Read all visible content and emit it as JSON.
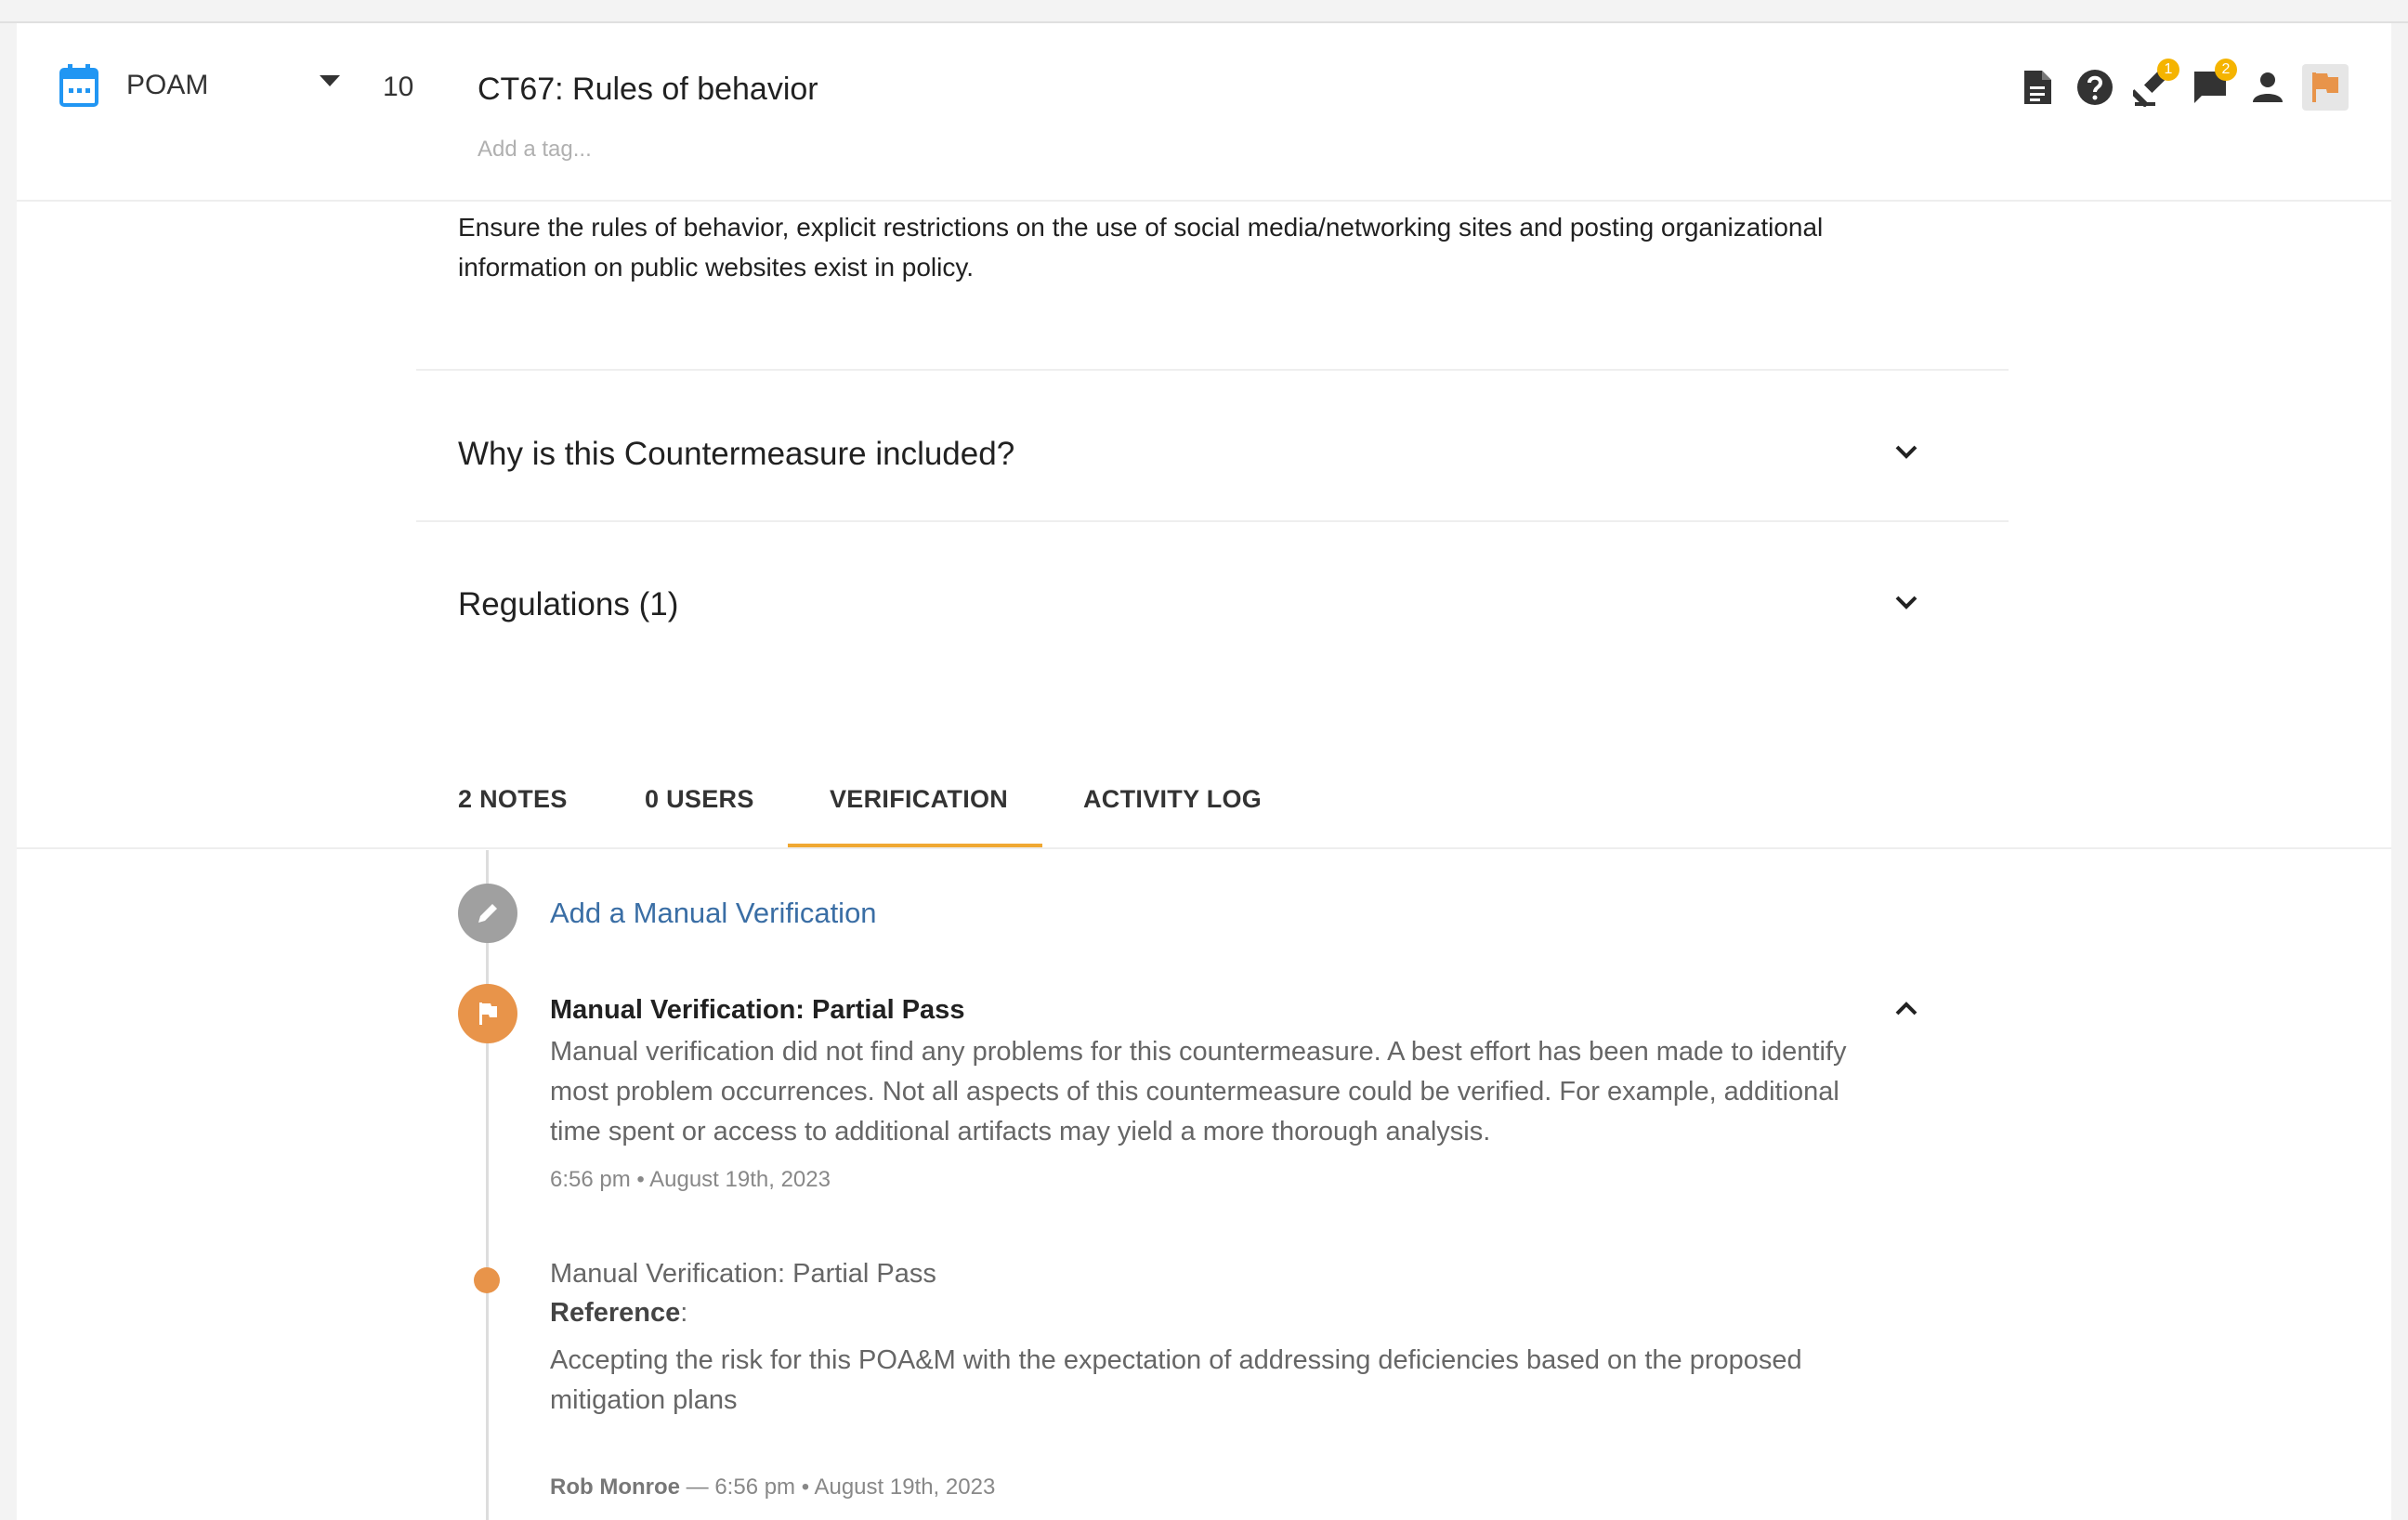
{
  "header": {
    "list_label": "POAM",
    "number": "10",
    "title": "CT67: Rules of behavior",
    "tag_placeholder": "Add a tag...",
    "badges": {
      "gavel": "1",
      "chat": "2"
    },
    "colors": {
      "calendar": "#2196f3",
      "flag": "#e8944a",
      "badge": "#f5b400"
    }
  },
  "description": "Ensure the rules of behavior, explicit restrictions on the use of social media/networking sites and posting organizational information on public websites exist in policy.",
  "accordions": [
    {
      "title": "Why is this Countermeasure included?"
    },
    {
      "title": "Regulations (1)"
    }
  ],
  "tabs": [
    {
      "label": "2 NOTES"
    },
    {
      "label": "0 USERS"
    },
    {
      "label": "VERIFICATION"
    },
    {
      "label": "ACTIVITY LOG"
    }
  ],
  "active_tab": "VERIFICATION",
  "timeline": {
    "add_label": "Add a Manual Verification",
    "verification": {
      "title": "Manual Verification: Partial Pass",
      "body": "Manual verification did not find any problems for this countermeasure. A best effort has been made to identify most problem occurrences. Not all aspects of this countermeasure could be verified. For example, additional time spent or access to additional artifacts may yield a more thorough analysis.",
      "time": "6:56 pm • August 19th, 2023"
    },
    "entry": {
      "title": "Manual Verification: Partial Pass",
      "reference_label": "Reference",
      "reference_suffix": ":",
      "body": "Accepting the risk for this POA&M with the expectation of addressing deficiencies based on the proposed mitigation plans",
      "author": "Rob Monroe",
      "separator": " — ",
      "time": "6:56 pm • August 19th, 2023"
    }
  }
}
